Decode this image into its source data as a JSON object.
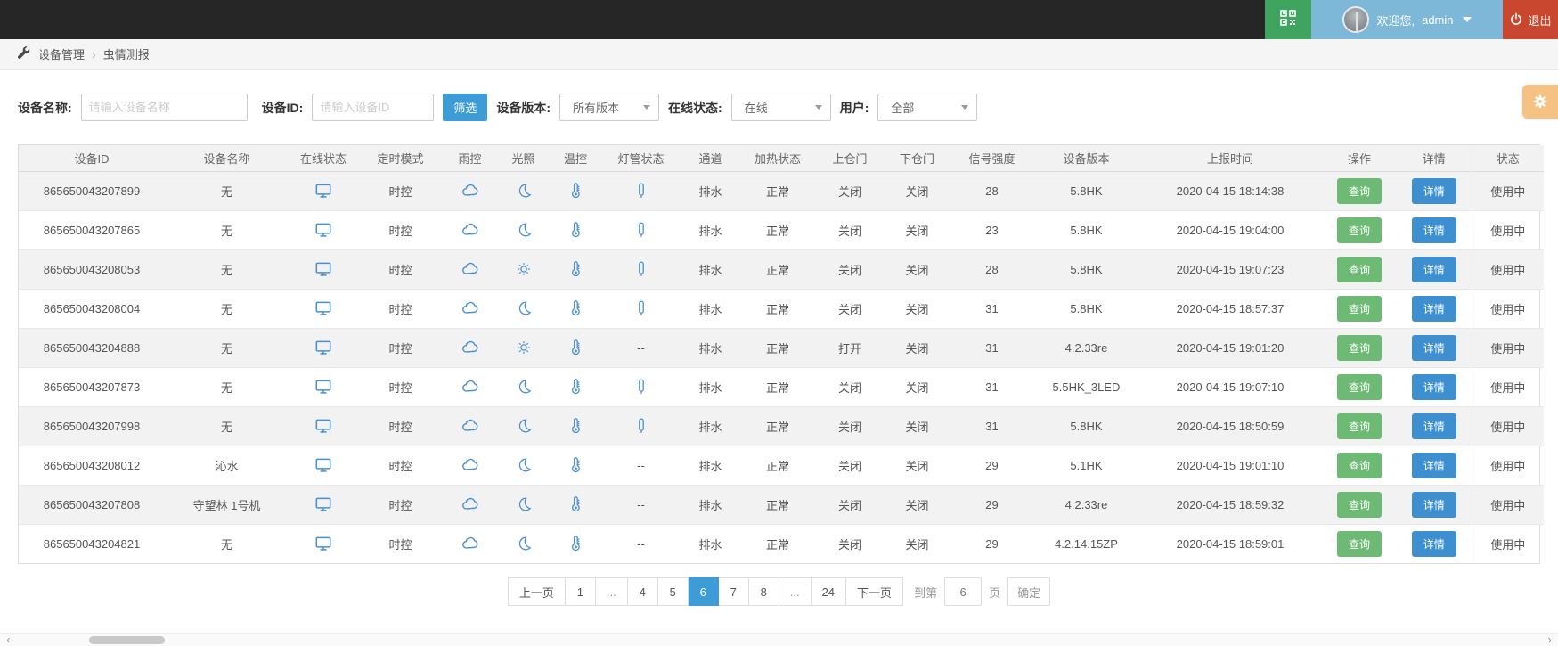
{
  "colors": {
    "topbar_bg": "#262626",
    "qr_button_bg": "#3fa45f",
    "user_area_bg": "#7db8d9",
    "logout_bg": "#c9472e",
    "accent_blue": "#3d9cd6",
    "icon_blue": "#4a90d2",
    "query_green": "#6cba73",
    "detail_blue": "#3d8fd0",
    "gear_tab_orange": "#f6c283"
  },
  "topbar": {
    "welcome_text": "欢迎您,",
    "username": "admin",
    "logout_label": "退出"
  },
  "breadcrumb": {
    "items": [
      "设备管理",
      "虫情测报"
    ],
    "separator": "›"
  },
  "filters": {
    "device_name_label": "设备名称:",
    "device_name_placeholder": "请输入设备名称",
    "device_id_label": "设备ID:",
    "device_id_placeholder": "请输入设备ID",
    "filter_button_label": "筛选",
    "version_label": "设备版本:",
    "version_value": "所有版本",
    "online_label": "在线状态:",
    "online_value": "在线",
    "user_label": "用户:",
    "user_value": "全部"
  },
  "table": {
    "columns": [
      "设备ID",
      "设备名称",
      "在线状态",
      "定时模式",
      "雨控",
      "光照",
      "温控",
      "灯管状态",
      "通道",
      "加热状态",
      "上仓门",
      "下仓门",
      "信号强度",
      "设备版本",
      "上报时间",
      "操作",
      "详情",
      "状态"
    ],
    "query_label": "查询",
    "detail_label": "详情",
    "empty_placeholder": "--",
    "rows": [
      {
        "device_id": "865650043207899",
        "device_name": "无",
        "online": "monitor",
        "timer_mode": "时控",
        "rain": "cloud",
        "light": "moon",
        "temp": "thermo",
        "lamp": "tube",
        "channel": "排水",
        "heating": "正常",
        "upper_door": "关闭",
        "lower_door": "关闭",
        "signal": "28",
        "version": "5.8HK",
        "report_time": "2020-04-15 18:14:38",
        "status": "使用中"
      },
      {
        "device_id": "865650043207865",
        "device_name": "无",
        "online": "monitor",
        "timer_mode": "时控",
        "rain": "cloud",
        "light": "moon",
        "temp": "thermo",
        "lamp": "tube",
        "channel": "排水",
        "heating": "正常",
        "upper_door": "关闭",
        "lower_door": "关闭",
        "signal": "23",
        "version": "5.8HK",
        "report_time": "2020-04-15 19:04:00",
        "status": "使用中"
      },
      {
        "device_id": "865650043208053",
        "device_name": "无",
        "online": "monitor",
        "timer_mode": "时控",
        "rain": "cloud",
        "light": "sun",
        "temp": "thermo",
        "lamp": "tube",
        "channel": "排水",
        "heating": "正常",
        "upper_door": "关闭",
        "lower_door": "关闭",
        "signal": "28",
        "version": "5.8HK",
        "report_time": "2020-04-15 19:07:23",
        "status": "使用中"
      },
      {
        "device_id": "865650043208004",
        "device_name": "无",
        "online": "monitor",
        "timer_mode": "时控",
        "rain": "cloud",
        "light": "moon",
        "temp": "thermo",
        "lamp": "tube",
        "channel": "排水",
        "heating": "正常",
        "upper_door": "关闭",
        "lower_door": "关闭",
        "signal": "31",
        "version": "5.8HK",
        "report_time": "2020-04-15 18:57:37",
        "status": "使用中"
      },
      {
        "device_id": "865650043204888",
        "device_name": "无",
        "online": "monitor",
        "timer_mode": "时控",
        "rain": "cloud",
        "light": "sun",
        "temp": "thermo",
        "lamp": "--",
        "channel": "排水",
        "heating": "正常",
        "upper_door": "打开",
        "lower_door": "关闭",
        "signal": "31",
        "version": "4.2.33re",
        "report_time": "2020-04-15 19:01:20",
        "status": "使用中"
      },
      {
        "device_id": "865650043207873",
        "device_name": "无",
        "online": "monitor",
        "timer_mode": "时控",
        "rain": "cloud",
        "light": "moon",
        "temp": "thermo",
        "lamp": "tube",
        "channel": "排水",
        "heating": "正常",
        "upper_door": "关闭",
        "lower_door": "关闭",
        "signal": "31",
        "version": "5.5HK_3LED",
        "report_time": "2020-04-15 19:07:10",
        "status": "使用中"
      },
      {
        "device_id": "865650043207998",
        "device_name": "无",
        "online": "monitor",
        "timer_mode": "时控",
        "rain": "cloud",
        "light": "moon",
        "temp": "thermo",
        "lamp": "tube",
        "channel": "排水",
        "heating": "正常",
        "upper_door": "关闭",
        "lower_door": "关闭",
        "signal": "31",
        "version": "5.8HK",
        "report_time": "2020-04-15 18:50:59",
        "status": "使用中"
      },
      {
        "device_id": "865650043208012",
        "device_name": "沁水",
        "online": "monitor",
        "timer_mode": "时控",
        "rain": "cloud",
        "light": "moon",
        "temp": "thermo",
        "lamp": "--",
        "channel": "排水",
        "heating": "正常",
        "upper_door": "关闭",
        "lower_door": "关闭",
        "signal": "29",
        "version": "5.1HK",
        "report_time": "2020-04-15 19:01:10",
        "status": "使用中"
      },
      {
        "device_id": "865650043207808",
        "device_name": "守望林 1号机",
        "online": "monitor",
        "timer_mode": "时控",
        "rain": "cloud",
        "light": "moon",
        "temp": "thermo",
        "lamp": "--",
        "channel": "排水",
        "heating": "正常",
        "upper_door": "关闭",
        "lower_door": "关闭",
        "signal": "29",
        "version": "4.2.33re",
        "report_time": "2020-04-15 18:59:32",
        "status": "使用中"
      },
      {
        "device_id": "865650043204821",
        "device_name": "无",
        "online": "monitor",
        "timer_mode": "时控",
        "rain": "cloud",
        "light": "moon",
        "temp": "thermo",
        "lamp": "--",
        "channel": "排水",
        "heating": "正常",
        "upper_door": "关闭",
        "lower_door": "关闭",
        "signal": "29",
        "version": "4.2.14.15ZP",
        "report_time": "2020-04-15 18:59:01",
        "status": "使用中"
      }
    ]
  },
  "pagination": {
    "prev_label": "上一页",
    "next_label": "下一页",
    "items": [
      "1",
      "...",
      "4",
      "5",
      "6",
      "7",
      "8",
      "...",
      "24"
    ],
    "active_page": "6",
    "goto_prefix": "到第",
    "goto_value": "6",
    "goto_suffix": "页",
    "confirm_label": "确定"
  }
}
